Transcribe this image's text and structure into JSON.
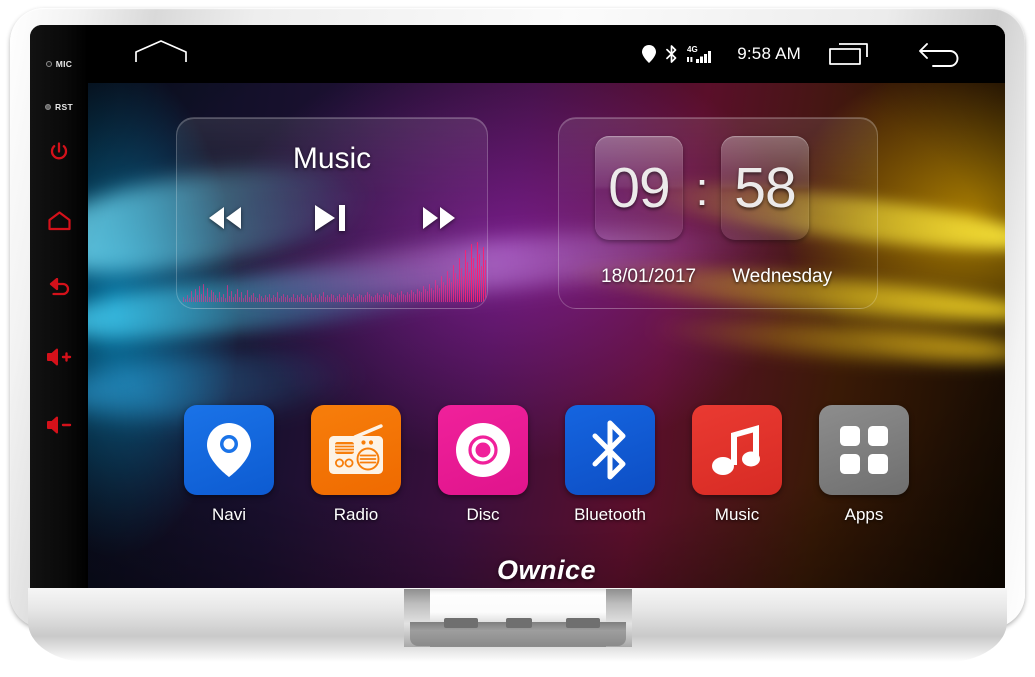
{
  "device": {
    "brand": "Ownice",
    "hardware_buttons": [
      {
        "name": "MIC",
        "label": "MIC",
        "type": "dot-label"
      },
      {
        "name": "RST",
        "label": "RST",
        "type": "dot-label"
      },
      {
        "name": "power",
        "label": "Power",
        "type": "icon"
      },
      {
        "name": "home",
        "label": "Home",
        "type": "icon"
      },
      {
        "name": "back",
        "label": "Back",
        "type": "icon"
      },
      {
        "name": "volume-up",
        "label": "Volume Up",
        "type": "icon"
      },
      {
        "name": "volume-down",
        "label": "Volume Down",
        "type": "icon"
      }
    ],
    "button_color": "#d4111a"
  },
  "statusbar": {
    "home_icon": "home-pentagon-icon",
    "icons": [
      "location-pin-icon",
      "bluetooth-icon",
      "signal-4g-icon"
    ],
    "network_label": "4G",
    "time": "9:58 AM",
    "recents_icon": "recents-icon",
    "back_icon": "back-arrow-icon"
  },
  "widgets": {
    "music": {
      "title": "Music",
      "prev_label": "Previous",
      "playpause_label": "Play / Pause",
      "next_label": "Next",
      "eq_levels": [
        8,
        5,
        12,
        6,
        18,
        9,
        22,
        11,
        26,
        14,
        30,
        10,
        24,
        8,
        20,
        16,
        12,
        7,
        17,
        9,
        13,
        6,
        28,
        10,
        19,
        8,
        14,
        22,
        9,
        16,
        7,
        12,
        20,
        8,
        11,
        15,
        9,
        6,
        13,
        10,
        7,
        12,
        8,
        14,
        6,
        11,
        9,
        16,
        7,
        10,
        13,
        8,
        12,
        6,
        9,
        14,
        7,
        11,
        8,
        13,
        10,
        6,
        12,
        9,
        15,
        8,
        11,
        7,
        13,
        10,
        16,
        9,
        12,
        8,
        14,
        11,
        7,
        10,
        13,
        9,
        12,
        8,
        15,
        11,
        9,
        13,
        7,
        10,
        14,
        12,
        9,
        11,
        16,
        13,
        10,
        8,
        12,
        15,
        11,
        9,
        14,
        12,
        10,
        16,
        13,
        11,
        9,
        15,
        12,
        18,
        14,
        11,
        16,
        13,
        20,
        17,
        14,
        22,
        19,
        16,
        26,
        21,
        18,
        30,
        24,
        20,
        36,
        28,
        24,
        44,
        34,
        28,
        52,
        40,
        33,
        62,
        48,
        38,
        74,
        57,
        44,
        86,
        66,
        50,
        96,
        74,
        56,
        100,
        80,
        60,
        92,
        70,
        52,
        78,
        58,
        46,
        64,
        48,
        38
      ]
    },
    "clock": {
      "hours": "09",
      "minutes": "58",
      "separator": ":",
      "date": "18/01/2017",
      "weekday": "Wednesday"
    }
  },
  "dock": {
    "apps": [
      {
        "label": "Navi",
        "icon": "navi-pin-icon",
        "color": "#1a73e8",
        "color2": "#0d5bd1"
      },
      {
        "label": "Radio",
        "icon": "radio-icon",
        "color": "#f77e0b",
        "color2": "#ef6a00"
      },
      {
        "label": "Disc",
        "icon": "disc-icon",
        "color": "#f0219b",
        "color2": "#e0148c"
      },
      {
        "label": "Bluetooth",
        "icon": "bluetooth-icon",
        "color": "#1565e0",
        "color2": "#0d4ec4"
      },
      {
        "label": "Music",
        "icon": "music-note-icon",
        "color": "#ea3a32",
        "color2": "#d72b24"
      },
      {
        "label": "Apps",
        "icon": "apps-grid-icon",
        "color": "#8d8d8d",
        "color2": "#6f6f6f"
      }
    ]
  }
}
